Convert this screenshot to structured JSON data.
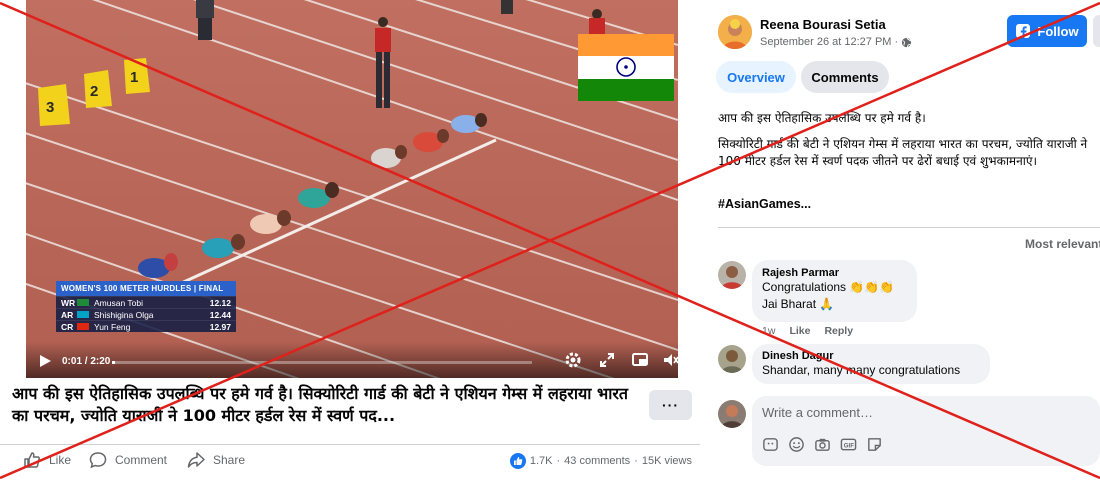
{
  "video": {
    "overlay": {
      "title": "WOMEN'S 100 METER HURDLES | FINAL",
      "rows": [
        {
          "code": "WR",
          "name": "Amusan Tobi",
          "time": "12.12",
          "flag_color": "#1f8a3a"
        },
        {
          "code": "AR",
          "name": "Shishigina Olga",
          "time": "12.44",
          "flag_color": "#00a3c6"
        },
        {
          "code": "CR",
          "name": "Yun Feng",
          "time": "12.97",
          "flag_color": "#de2910"
        }
      ]
    },
    "lane_markers": [
      "3",
      "2",
      "1"
    ],
    "time_readout": "0:01 / 2:20",
    "progress": 0.008,
    "icons": [
      "play-icon",
      "settings-icon",
      "fullscreen-icon",
      "picture-in-picture-icon",
      "volume-icon"
    ]
  },
  "post": {
    "title": "आप की इस ऐतिहासिक उपलब्धि पर हमे गर्व है। सिक्योरिटी गार्ड की बेटी ने एशियन गेम्स में लहराया भारत का परचम, ज्योति याराजी ने 100 मीटर हर्डल रेस में स्वर्ण पद...",
    "more_label": "···",
    "actions": {
      "like": "Like",
      "comment": "Comment",
      "share": "Share"
    },
    "stats": {
      "reactions": "1.7K",
      "comments": "43 comments",
      "views": "15K views"
    }
  },
  "sidebar": {
    "author": "Reena Bourasi Setia",
    "meta": "September 26 at 12:27 PM ·",
    "follow_label": "Follow",
    "tabs": {
      "overview": "Overview",
      "comments": "Comments"
    },
    "text_line1": "आप की इस ऐतिहासिक उपलब्धि पर हमे गर्व है।",
    "text_body": "सिक्योरिटी गार्ड की बेटी ने एशियन गेम्स में लहराया भारत का परचम, ज्योति याराजी ने 100 मीटर हर्डल रेस में स्वर्ण पदक जीतने पर ढेरों बधाई एवं शुभकामनाएं।",
    "hashtag": "#AsianGames...",
    "sort_label": "Most relevant",
    "comments": [
      {
        "author": "Rajesh Parmar",
        "line1": "Congratulations 👏👏👏",
        "line2": "Jai Bharat 🙏",
        "time": "1w",
        "like": "Like",
        "reply": "Reply"
      },
      {
        "author": "Dinesh Dagur",
        "line1": "Shandar, many many congratulations"
      }
    ],
    "compose_placeholder": "Write a comment…",
    "compose_icons": [
      "avatar-sticker-icon",
      "emoji-icon",
      "camera-icon",
      "gif-icon",
      "sticker-icon"
    ]
  },
  "colors": {
    "fb_blue": "#1877f2",
    "track": "#b86758",
    "stamp_red": "#e0201b"
  }
}
